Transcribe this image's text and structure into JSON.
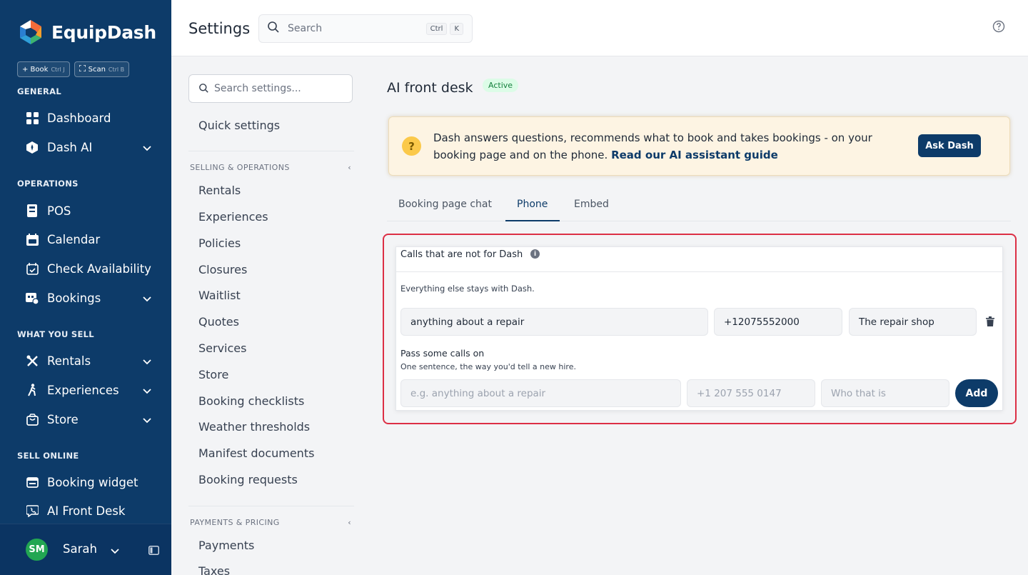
{
  "app": {
    "name": "EquipDash"
  },
  "quick_actions": [
    {
      "icon": "plus-icon",
      "label": "+ Book",
      "shortcut": "Ctrl J"
    },
    {
      "icon": "scan-icon",
      "label": "Scan",
      "shortcut": "Ctrl B"
    }
  ],
  "sidebar": {
    "sections": [
      "GENERAL",
      "OPERATIONS",
      "WHAT YOU SELL",
      "SELL ONLINE"
    ],
    "items": [
      {
        "label": "Dashboard",
        "icon": "grid-icon"
      },
      {
        "label": "Dash AI",
        "icon": "ai-icon"
      },
      {
        "label": "POS",
        "icon": "pos-icon"
      },
      {
        "label": "Calendar",
        "icon": "calendar-icon"
      },
      {
        "label": "Check Availability",
        "icon": "calendar-check-icon"
      },
      {
        "label": "Bookings",
        "icon": "bookings-icon"
      },
      {
        "label": "Rentals",
        "icon": "tools-icon"
      },
      {
        "label": "Experiences",
        "icon": "hiker-icon"
      },
      {
        "label": "Store",
        "icon": "bag-icon"
      },
      {
        "label": "Booking widget",
        "icon": "widget-icon"
      },
      {
        "label": "AI Front Desk",
        "icon": "phone-chat-icon"
      }
    ]
  },
  "user": {
    "initials": "SM",
    "name": "Sarah",
    "avatar_color": "#22a652"
  },
  "header": {
    "title": "Settings",
    "search_placeholder": "Search",
    "shortcut_keys": [
      "Ctrl",
      "K"
    ]
  },
  "settings_nav": {
    "search_placeholder": "Search settings...",
    "quick": "Quick settings",
    "section_selling": "SELLING & OPERATIONS",
    "selling_items": [
      "Rentals",
      "Experiences",
      "Policies",
      "Closures",
      "Waitlist",
      "Quotes",
      "Services",
      "Store",
      "Booking checklists",
      "Weather thresholds",
      "Manifest documents",
      "Booking requests"
    ],
    "section_payments": "PAYMENTS & PRICING",
    "payment_items": [
      "Payments",
      "Taxes"
    ],
    "collapse_glyph": "‹"
  },
  "main": {
    "title": "AI front desk",
    "status_badge": "Active",
    "banner": {
      "text": "Dash answers questions, recommends what to book and takes bookings - on your booking page and on the phone.",
      "link": "Read our AI assistant guide",
      "button": "Ask Dash"
    },
    "tabs": [
      "Booking page chat",
      "Phone",
      "Embed"
    ],
    "active_tab": "Phone",
    "card": {
      "title": "Calls that are not for Dash",
      "info_glyph": "i",
      "subtitle": "Everything else stays with Dash.",
      "rule": {
        "topic": "anything about a repair",
        "phone": "+12075552000",
        "who": "The repair shop"
      },
      "pass_title": "Pass some calls on",
      "pass_sub": "One sentence, the way you'd tell a new hire.",
      "new_rule": {
        "topic_placeholder": "e.g. anything about a repair",
        "phone_placeholder": "+1 207 555 0147",
        "who_placeholder": "Who that is"
      },
      "add_button": "Add"
    }
  },
  "colors": {
    "sidebar": "#0d3b69",
    "accent": "#0d3b69",
    "highlight": "#dc2f45",
    "banner_bg": "#fdf4e3",
    "badge_bg": "#dcfce7",
    "badge_text": "#15803d"
  }
}
